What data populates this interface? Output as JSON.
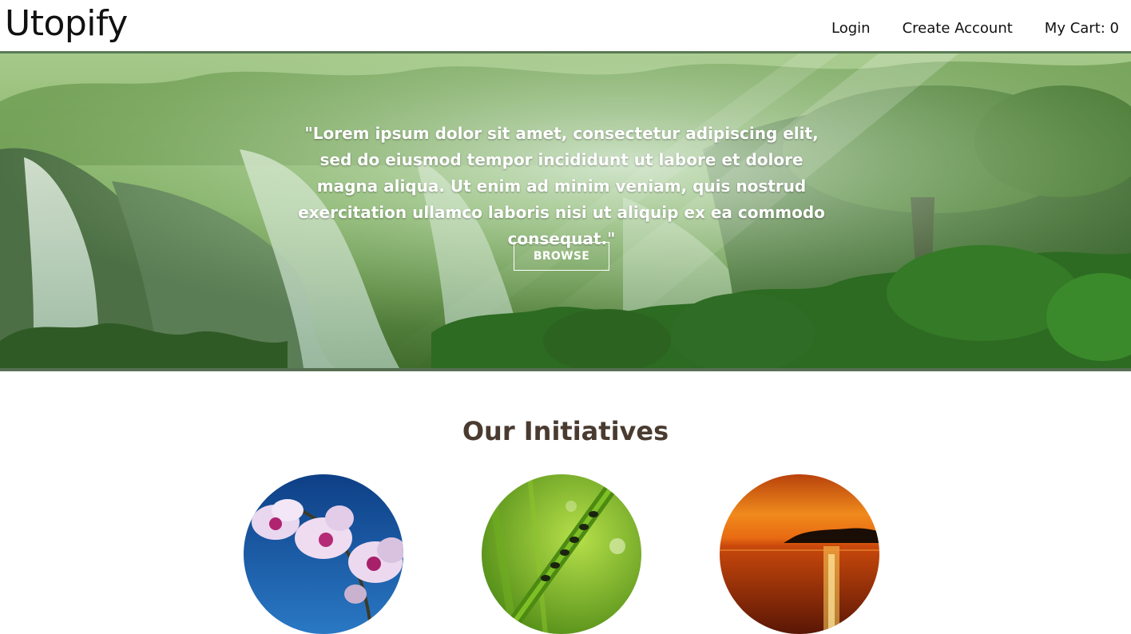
{
  "header": {
    "logo": "Utopify",
    "nav": {
      "login": "Login",
      "create_account": "Create Account",
      "cart": "My Cart: 0"
    }
  },
  "hero": {
    "quote": "\"Lorem ipsum dolor sit amet, consectetur adipiscing elit, sed do eiusmod tempor incididunt ut labore et dolore magna aliqua. Ut enim ad minim veniam, quis nostrud exercitation ullamco laboris nisi ut aliquip ex ea commodo consequat.\"",
    "button": "BROWSE"
  },
  "initiatives": {
    "title": "Our Initiatives"
  },
  "colors": {
    "accent_border": "#5a7a55",
    "title_text": "#4a3b30"
  }
}
